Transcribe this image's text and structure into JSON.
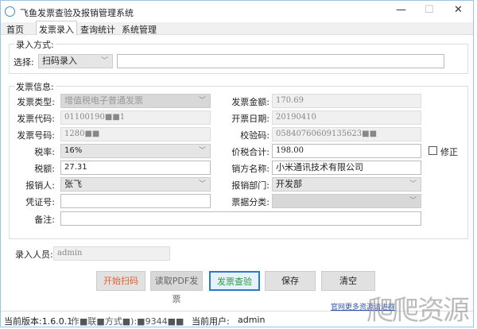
{
  "window": {
    "title": "飞鱼发票查验及报销管理系统",
    "minimize": "—",
    "maximize": "☐",
    "close": "✕"
  },
  "tabs": [
    {
      "label": "首页"
    },
    {
      "label": "发票录入",
      "active": true
    },
    {
      "label": "查询统计"
    },
    {
      "label": "系统管理"
    }
  ],
  "entry_mode": {
    "group_label": "录入方式:",
    "select_label": "选择:",
    "select_value": "扫码录入",
    "scan_input": ""
  },
  "invoice": {
    "group_label": "发票信息:",
    "type_label": "发票类型:",
    "type_value": "增值税电子普通发票",
    "code_label": "发票代码:",
    "code_value": "01100190■■1",
    "number_label": "发票号码:",
    "number_value": "1280■■",
    "tax_rate_label": "税率:",
    "tax_rate_value": "16%",
    "tax_label": "税额:",
    "tax_value": "27.31",
    "claimant_label": "报销人:",
    "claimant_value": "张飞",
    "voucher_label": "凭证号:",
    "voucher_value": "",
    "remark_label": "备注:",
    "remark_value": "",
    "amount_label": "发票金额:",
    "amount_value": "170.69",
    "date_label": "开票日期:",
    "date_value": "20190410",
    "check_label": "校验码:",
    "check_value": "05840760609135623■■",
    "total_label": "价税合计:",
    "total_value": "198.00",
    "correct_label": "修正",
    "correct_checked": false,
    "seller_label": "销方名称:",
    "seller_value": "小米通讯技术有限公司",
    "dept_label": "报销部门:",
    "dept_value": "开发部",
    "category_label": "票据分类:",
    "category_value": ""
  },
  "operator": {
    "label": "录入人员:",
    "value": "admin"
  },
  "buttons": {
    "scan": "开始扫码",
    "pdf": "读取PDF发票",
    "verify": "发票查验",
    "save": "保存",
    "clear": "清空"
  },
  "status": {
    "version": "当前版本:1.6.0.1",
    "contact": "作■联■方式■):■9344■■",
    "user_label": "当前用户:",
    "user": "admin",
    "link": "官网更多资源请进群"
  },
  "watermark": "爬爬资源",
  "colors": {
    "scan": "#e0602a",
    "verify": "#2a9a3a",
    "verify_border": "#2a78c8"
  }
}
